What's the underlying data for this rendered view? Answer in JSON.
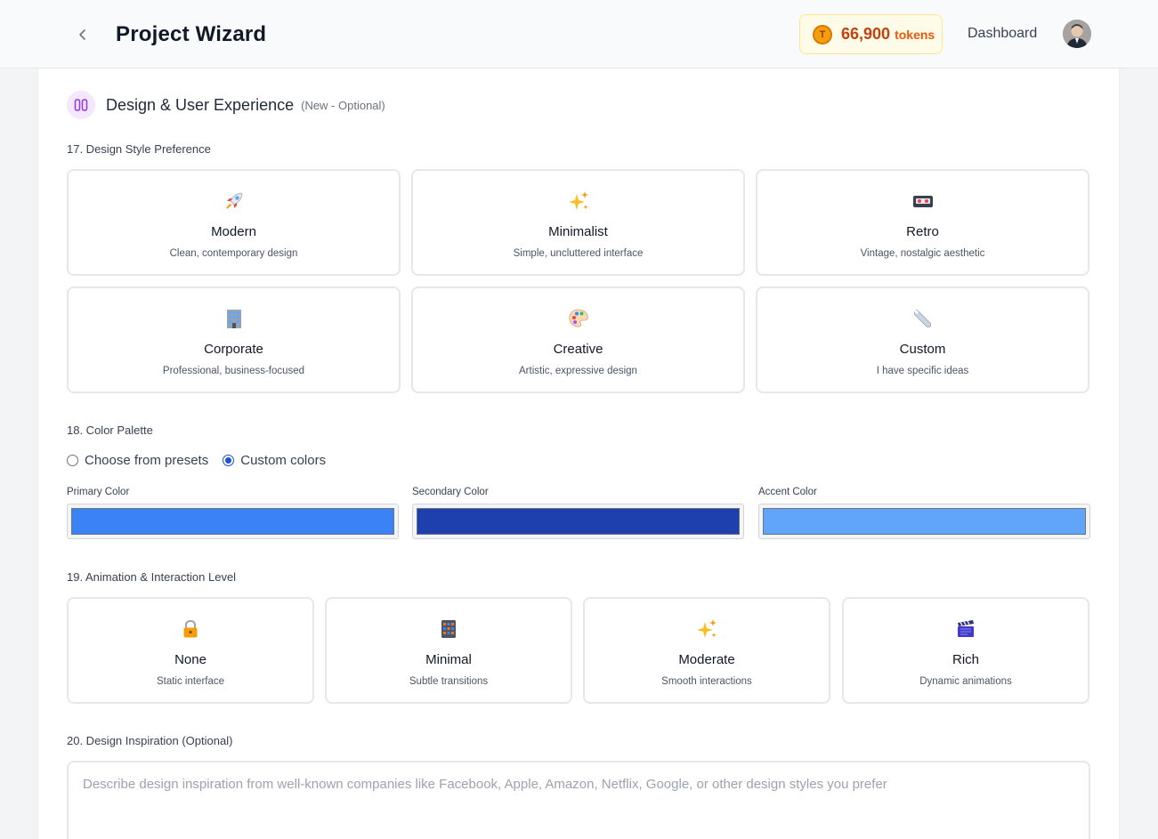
{
  "header": {
    "title": "Project Wizard",
    "tokens": {
      "count": "66,900",
      "unit": "tokens",
      "coin_letter": "T"
    },
    "nav_link": "Dashboard"
  },
  "section": {
    "title": "Design & User Experience",
    "note": "(New - Optional)"
  },
  "design_style": {
    "label": "17. Design Style Preference",
    "options": [
      {
        "icon": "rocket-icon",
        "name": "Modern",
        "desc": "Clean, contemporary design"
      },
      {
        "icon": "sparkles-icon",
        "name": "Minimalist",
        "desc": "Simple, uncluttered interface"
      },
      {
        "icon": "videocassette-icon",
        "name": "Retro",
        "desc": "Vintage, nostalgic aesthetic"
      },
      {
        "icon": "office-building-icon",
        "name": "Corporate",
        "desc": "Professional, business-focused"
      },
      {
        "icon": "palette-icon",
        "name": "Creative",
        "desc": "Artistic, expressive design"
      },
      {
        "icon": "wrench-icon",
        "name": "Custom",
        "desc": "I have specific ideas"
      }
    ]
  },
  "color_palette": {
    "label": "18. Color Palette",
    "modes": [
      {
        "label": "Choose from presets",
        "selected": false
      },
      {
        "label": "Custom colors",
        "selected": true
      }
    ],
    "colors": [
      {
        "label": "Primary Color",
        "value": "#3b82f6"
      },
      {
        "label": "Secondary Color",
        "value": "#1e40af"
      },
      {
        "label": "Accent Color",
        "value": "#60a5fa"
      }
    ]
  },
  "animation": {
    "label": "19. Animation & Interaction Level",
    "options": [
      {
        "icon": "lock-icon",
        "name": "None",
        "desc": "Static interface"
      },
      {
        "icon": "abacus-icon",
        "name": "Minimal",
        "desc": "Subtle transitions"
      },
      {
        "icon": "sparkles-icon",
        "name": "Moderate",
        "desc": "Smooth interactions"
      },
      {
        "icon": "clapper-board-icon",
        "name": "Rich",
        "desc": "Dynamic animations"
      }
    ]
  },
  "inspiration": {
    "label": "20. Design Inspiration (Optional)",
    "placeholder": "Describe design inspiration from well-known companies like Facebook, Apple, Amazon, Netflix, Google, or other design styles you prefer"
  }
}
